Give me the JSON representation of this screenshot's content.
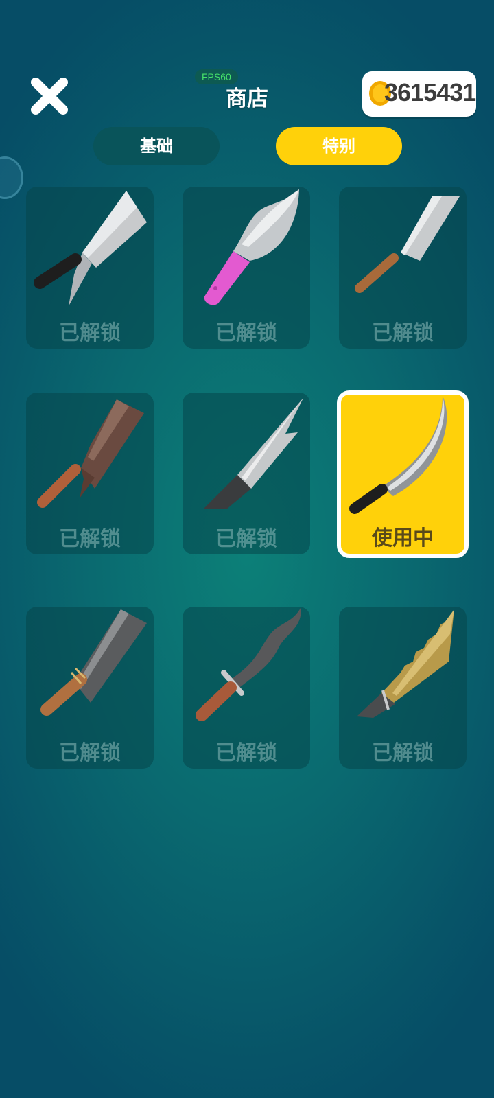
{
  "header": {
    "title": "商店",
    "fps": "FPS60",
    "coins": "3615431"
  },
  "tabs": [
    {
      "label": "基础",
      "active": false
    },
    {
      "label": "特别",
      "active": true
    }
  ],
  "colors": {
    "accent": "#ffd10a",
    "card_bg": "#0a545a",
    "background": "#0a6a70"
  },
  "items": [
    {
      "icon": "cleaver-knife-icon",
      "status": "已解锁"
    },
    {
      "icon": "pink-handle-knife-icon",
      "status": "已解锁"
    },
    {
      "icon": "chef-knife-icon",
      "status": "已解锁"
    },
    {
      "icon": "rusty-cleaver-icon",
      "status": "已解锁"
    },
    {
      "icon": "hook-dagger-icon",
      "status": "已解锁"
    },
    {
      "icon": "curved-blade-icon",
      "status": "使用中",
      "selected": true
    },
    {
      "icon": "machete-icon",
      "status": "已解锁"
    },
    {
      "icon": "wavy-dagger-icon",
      "status": "已解锁"
    },
    {
      "icon": "serrated-gold-blade-icon",
      "status": "已解锁"
    }
  ]
}
